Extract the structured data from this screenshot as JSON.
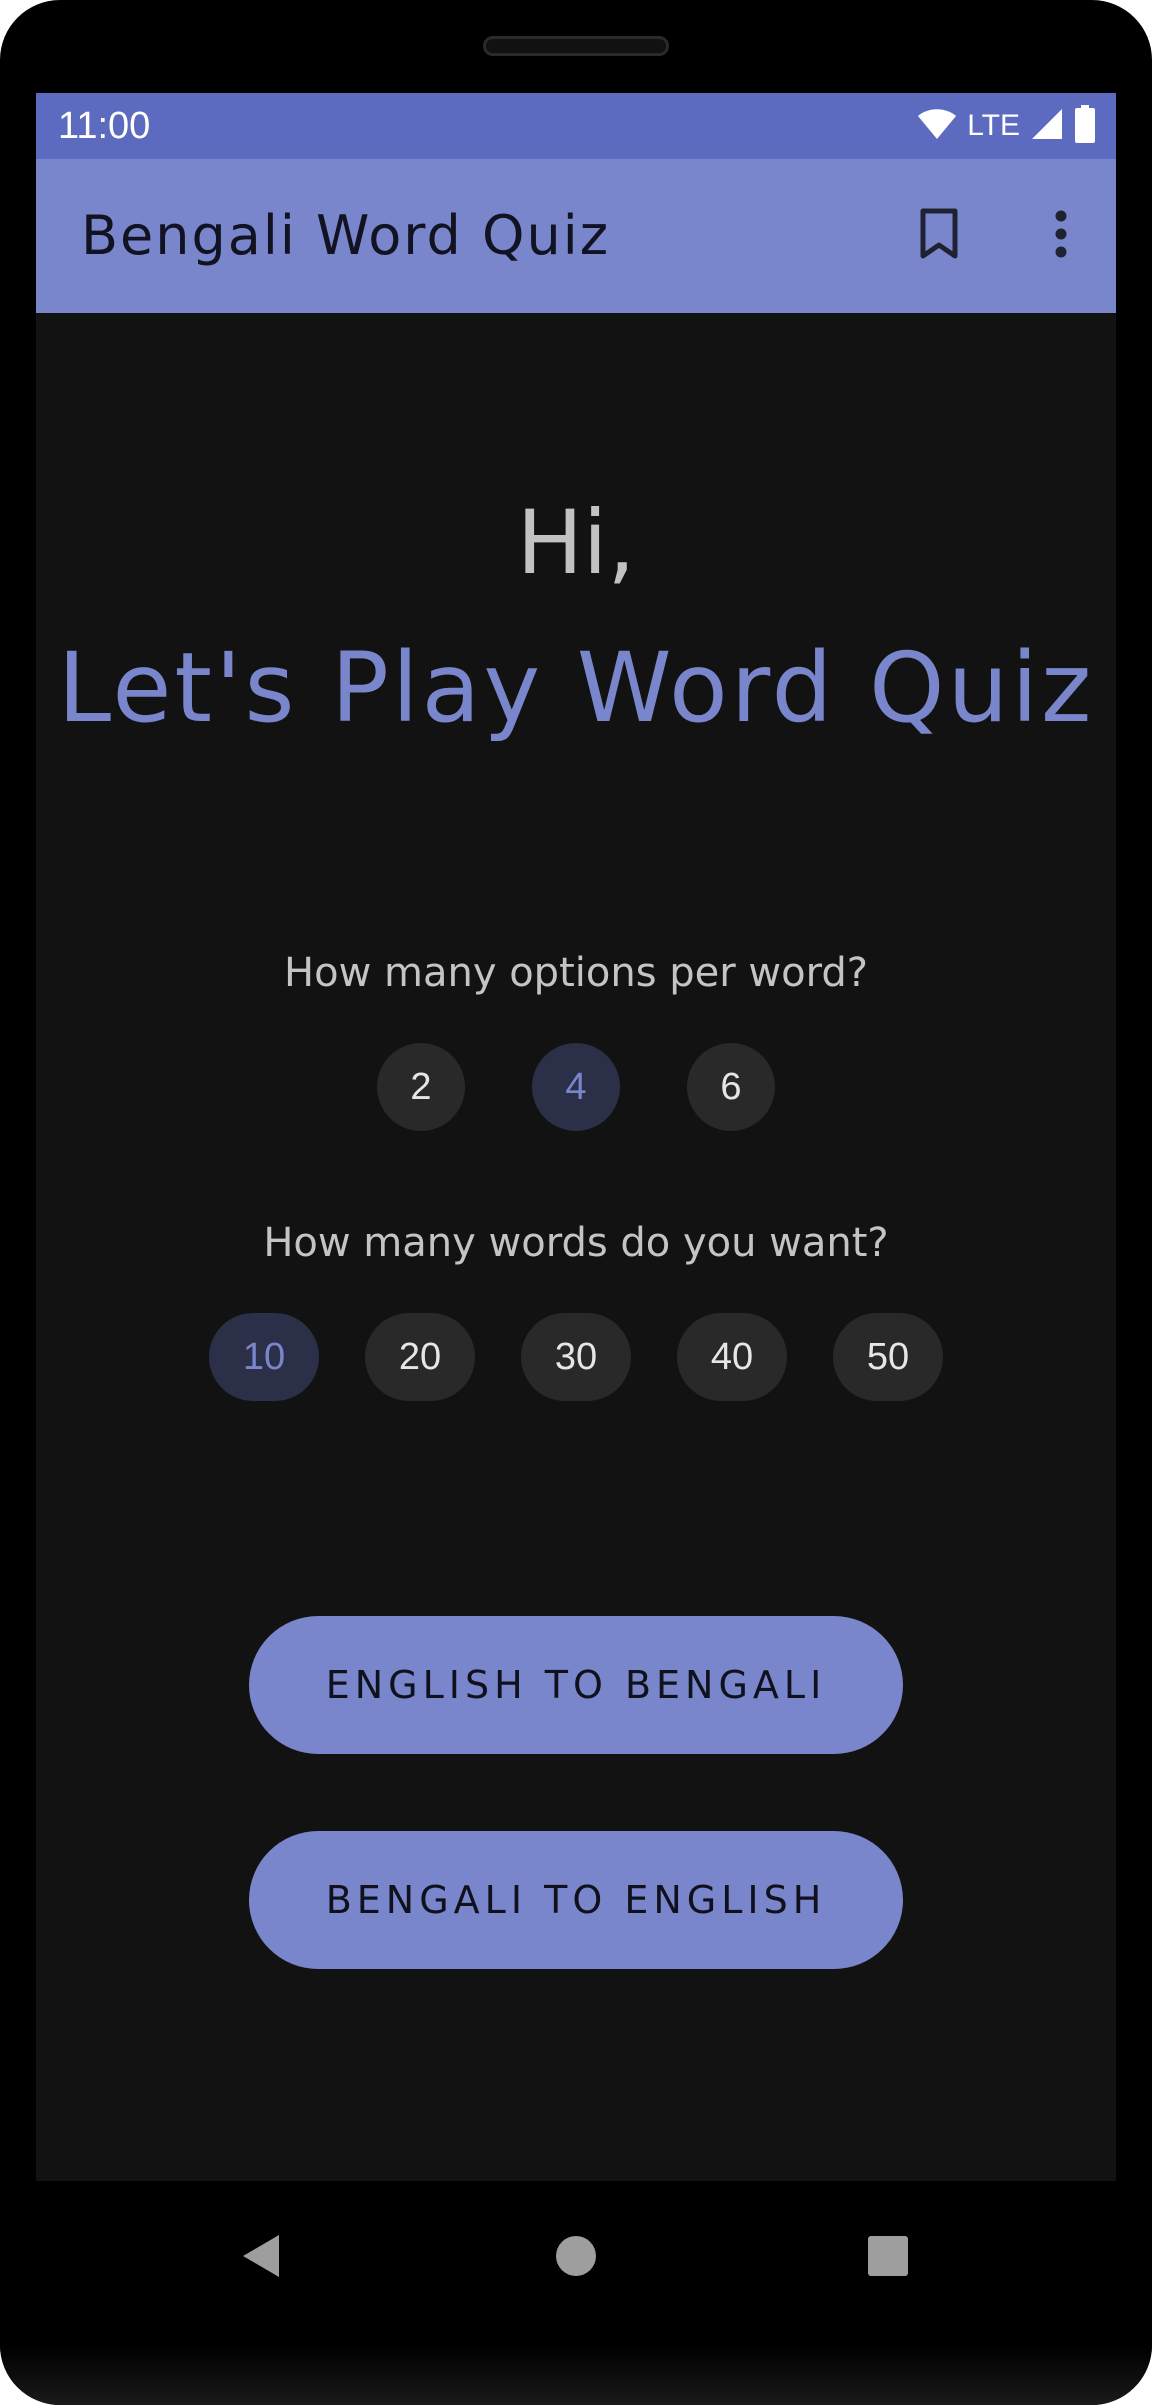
{
  "status_bar": {
    "time": "11:00",
    "network": "LTE",
    "icons": [
      "wifi-icon",
      "signal-icon",
      "battery-icon"
    ]
  },
  "app_bar": {
    "title": "Bengali Word Quiz",
    "actions": [
      "bookmark-icon",
      "more-vert-icon"
    ]
  },
  "main": {
    "greeting": "Hi,",
    "headline": "Let's Play Word Quiz",
    "options_question": "How many options per word?",
    "options": [
      "2",
      "4",
      "6"
    ],
    "options_selected": "4",
    "words_question": "How many words do you want?",
    "word_counts": [
      "10",
      "20",
      "30",
      "40",
      "50"
    ],
    "words_selected": "10",
    "buttons": {
      "english_to_bengali": "ENGLISH TO BENGALI",
      "bengali_to_english": "BENGALI TO ENGLISH"
    }
  },
  "nav_bar": {
    "icons": [
      "back-icon",
      "home-icon",
      "recents-icon"
    ]
  },
  "colors": {
    "accent": "#7986cb",
    "status_bar": "#5c6bc0",
    "background": "#121212",
    "chip": "#292929",
    "chip_selected": "#2b2f47"
  }
}
